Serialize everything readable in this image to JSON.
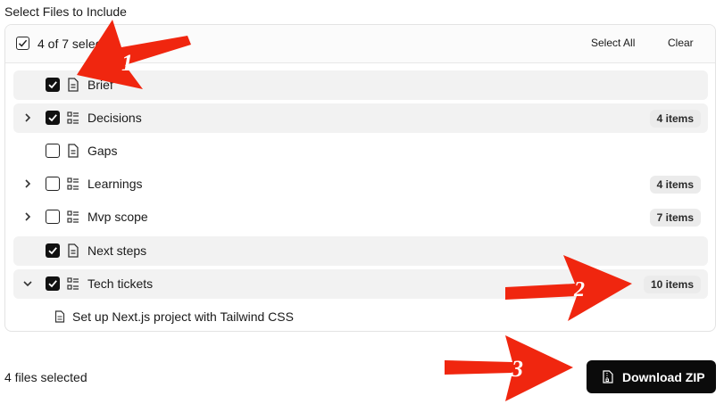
{
  "section_title": "Select Files to Include",
  "header": {
    "selection_count": "4 of 7 selected",
    "select_all_label": "Select All",
    "clear_label": "Clear"
  },
  "rows": [
    {
      "label": "Brief",
      "checked": true,
      "expandable": false,
      "icon": "document-icon",
      "badge": ""
    },
    {
      "label": "Decisions",
      "checked": true,
      "expandable": true,
      "expanded": false,
      "icon": "list-icon",
      "badge": "4 items"
    },
    {
      "label": "Gaps",
      "checked": false,
      "expandable": false,
      "icon": "document-icon",
      "badge": ""
    },
    {
      "label": "Learnings",
      "checked": false,
      "expandable": true,
      "expanded": false,
      "icon": "list-icon",
      "badge": "4 items"
    },
    {
      "label": "Mvp scope",
      "checked": false,
      "expandable": true,
      "expanded": false,
      "icon": "list-icon",
      "badge": "7 items"
    },
    {
      "label": "Next steps",
      "checked": true,
      "expandable": false,
      "icon": "document-icon",
      "badge": ""
    },
    {
      "label": "Tech tickets",
      "checked": true,
      "expandable": true,
      "expanded": true,
      "icon": "list-icon",
      "badge": "10 items"
    }
  ],
  "sub_item": {
    "label": "Set up Next.js project with Tailwind CSS",
    "icon": "document-icon"
  },
  "footer": {
    "files_selected": "4 files selected",
    "download_label": "Download ZIP",
    "download_icon": "zip-file-icon"
  },
  "annotations": [
    "1",
    "2",
    "3"
  ],
  "colors": {
    "annotation_arrow": "#f0260f",
    "button": "#0b0b0b",
    "selected_row": "#f2f2f2"
  }
}
